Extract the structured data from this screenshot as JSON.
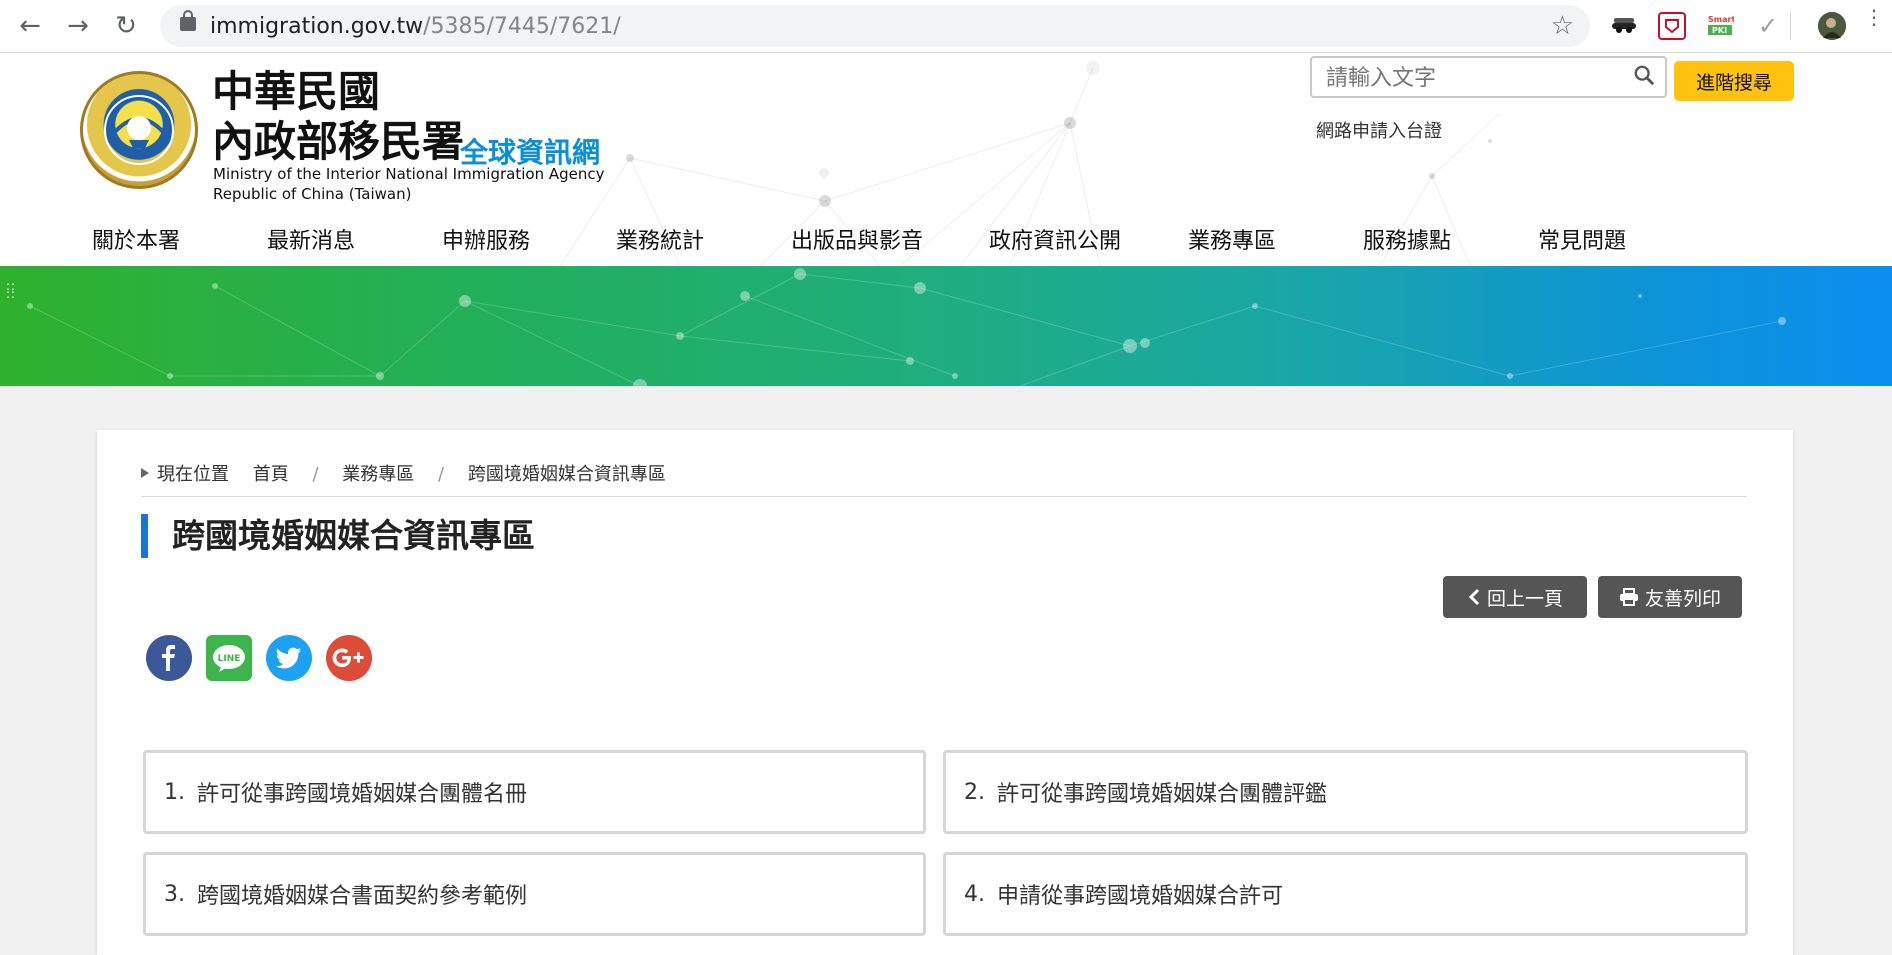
{
  "browser": {
    "url_domain": "immigration.gov.tw",
    "url_path": "/5385/7445/7621/"
  },
  "header": {
    "title_line1": "中華民國",
    "title_line2": "內政部移民署",
    "title_global": "全球資訊網",
    "title_en_line1": "Ministry of the Interior National Immigration Agency",
    "title_en_line2": "Republic of China (Taiwan)",
    "search_placeholder": "請輸入文字",
    "advanced_search_label": "進階搜尋",
    "apply_link_label": "網路申請入台證"
  },
  "nav": {
    "items": [
      "關於本署",
      "最新消息",
      "申辦服務",
      "業務統計",
      "出版品與影音",
      "政府資訊公開",
      "業務專區",
      "服務據點",
      "常見問題"
    ]
  },
  "breadcrumb": {
    "label": "現在位置",
    "items": [
      "首頁",
      "業務專區",
      "跨國境婚姻媒合資訊專區"
    ]
  },
  "page": {
    "title": "跨國境婚姻媒合資訊專區",
    "back_label": "回上一頁",
    "print_label": "友善列印"
  },
  "share": {
    "icons": [
      "facebook-icon",
      "line-icon",
      "twitter-icon",
      "google-plus-icon"
    ],
    "line_text": "LINE"
  },
  "list": [
    {
      "num": "1.",
      "label": "許可從事跨國境婚姻媒合團體名冊"
    },
    {
      "num": "2.",
      "label": "許可從事跨國境婚姻媒合團體評鑑"
    },
    {
      "num": "3.",
      "label": "跨國境婚姻媒合書面契約參考範例"
    },
    {
      "num": "4.",
      "label": "申請從事跨國境婚姻媒合許可"
    }
  ],
  "colors": {
    "accent_blue": "#1976d2",
    "advanced_search_bg": "#ffc20e",
    "dark_button": "#555555",
    "facebook": "#3b5998",
    "line": "#3cb64a",
    "twitter": "#1da1f2",
    "google_plus": "#dd4b39"
  }
}
